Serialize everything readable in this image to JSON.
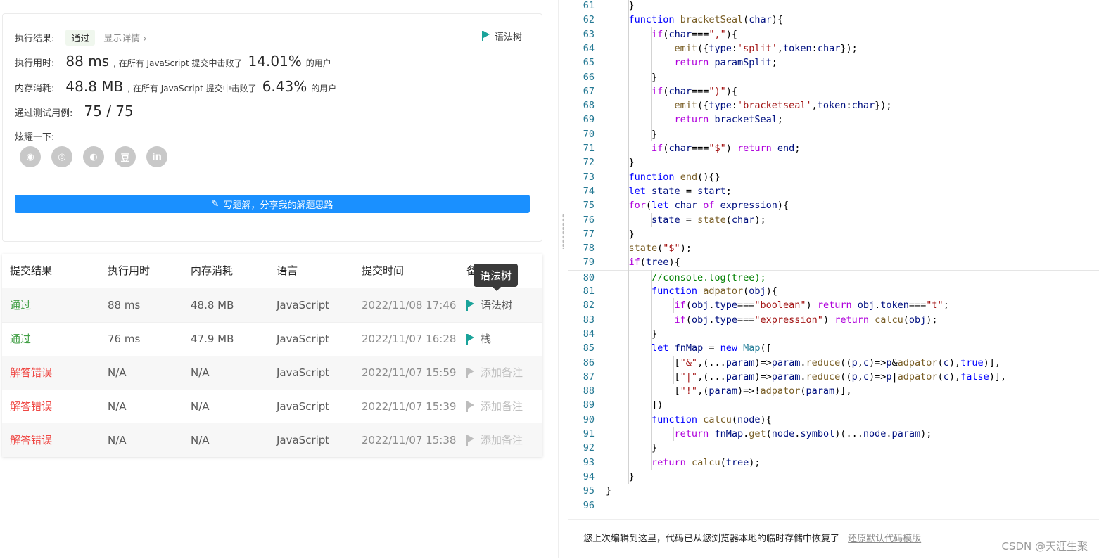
{
  "result": {
    "label": "执行结果:",
    "status": "通过",
    "detail_link": "显示详情 ›",
    "ast_button": "语法树",
    "runtime_label": "执行用时:",
    "runtime_value": "88 ms",
    "runtime_text": ", 在所有 JavaScript 提交中击败了",
    "runtime_pct": "14.01%",
    "runtime_suffix": "的用户",
    "memory_label": "内存消耗:",
    "memory_value": "48.8 MB",
    "memory_text": ", 在所有 JavaScript 提交中击败了",
    "memory_pct": "6.43%",
    "memory_suffix": "的用户",
    "cases_label": "通过测试用例:",
    "cases_value": "75 / 75",
    "share_label": "炫耀一下:",
    "write_button": "写题解，分享我的解题思路"
  },
  "table": {
    "headers": [
      "提交结果",
      "执行用时",
      "内存消耗",
      "语言",
      "提交时间",
      "备注"
    ],
    "rows": [
      {
        "status": "通过",
        "runtime": "88 ms",
        "memory": "48.8 MB",
        "lang": "JavaScript",
        "time": "2022/11/08 17:46",
        "note": "语法树"
      },
      {
        "status": "通过",
        "runtime": "76 ms",
        "memory": "47.9 MB",
        "lang": "JavaScript",
        "time": "2022/11/07 16:28",
        "note": "栈"
      },
      {
        "status": "解答错误",
        "runtime": "N/A",
        "memory": "N/A",
        "lang": "JavaScript",
        "time": "2022/11/07 15:59",
        "note": "添加备注"
      },
      {
        "status": "解答错误",
        "runtime": "N/A",
        "memory": "N/A",
        "lang": "JavaScript",
        "time": "2022/11/07 15:39",
        "note": "添加备注"
      },
      {
        "status": "解答错误",
        "runtime": "N/A",
        "memory": "N/A",
        "lang": "JavaScript",
        "time": "2022/11/07 15:38",
        "note": "添加备注"
      }
    ],
    "tooltip": "语法树"
  },
  "colors": {
    "accent": "#1a90ff",
    "success": "#43a047",
    "error": "#ef4743",
    "flag": "#1aa39a"
  },
  "icons": [
    "wechat-icon",
    "weibo-icon",
    "qq-icon",
    "douban-icon",
    "linkedin-icon",
    "flag-icon",
    "pencil-icon"
  ],
  "share_icons": [
    "◉",
    "◎",
    "◐",
    "豆",
    "in"
  ],
  "editor": {
    "first_line": 61,
    "current_line": 80,
    "lines": [
      "    }",
      "    function bracketSeal(char){",
      "        if(char===\",\"){",
      "            emit({type:'split',token:char});",
      "            return paramSplit;",
      "        }",
      "        if(char===\")\"){",
      "            emit({type:'bracketseal',token:char});",
      "            return bracketSeal;",
      "        }",
      "        if(char===\"$\") return end;",
      "    }",
      "    function end(){}",
      "    let state = start;",
      "    for(let char of expression){",
      "        state = state(char);",
      "    }",
      "    state(\"$\");",
      "    if(tree){",
      "        //console.log(tree);",
      "        function adpator(obj){",
      "            if(obj.type===\"boolean\") return obj.token===\"t\";",
      "            if(obj.type===\"expression\") return calcu(obj);",
      "        }",
      "        let fnMap = new Map([",
      "            [\"&\",(...param)=>param.reduce((p,c)=>p&adpator(c),true)],",
      "            [\"|\",(...param)=>param.reduce((p,c)=>p|adpator(c),false)],",
      "            [\"!\",(param)=>!adpator(param)],",
      "        ])",
      "        function calcu(node){",
      "            return fnMap.get(node.symbol)(...node.param);",
      "        }",
      "        return calcu(tree);",
      "    }",
      "}",
      ""
    ]
  },
  "footer": {
    "message": "您上次编辑到这里，代码已从您浏览器本地的临时存储中恢复了",
    "restore_link": "还原默认代码模版"
  },
  "watermark": "CSDN @天涯生聚"
}
